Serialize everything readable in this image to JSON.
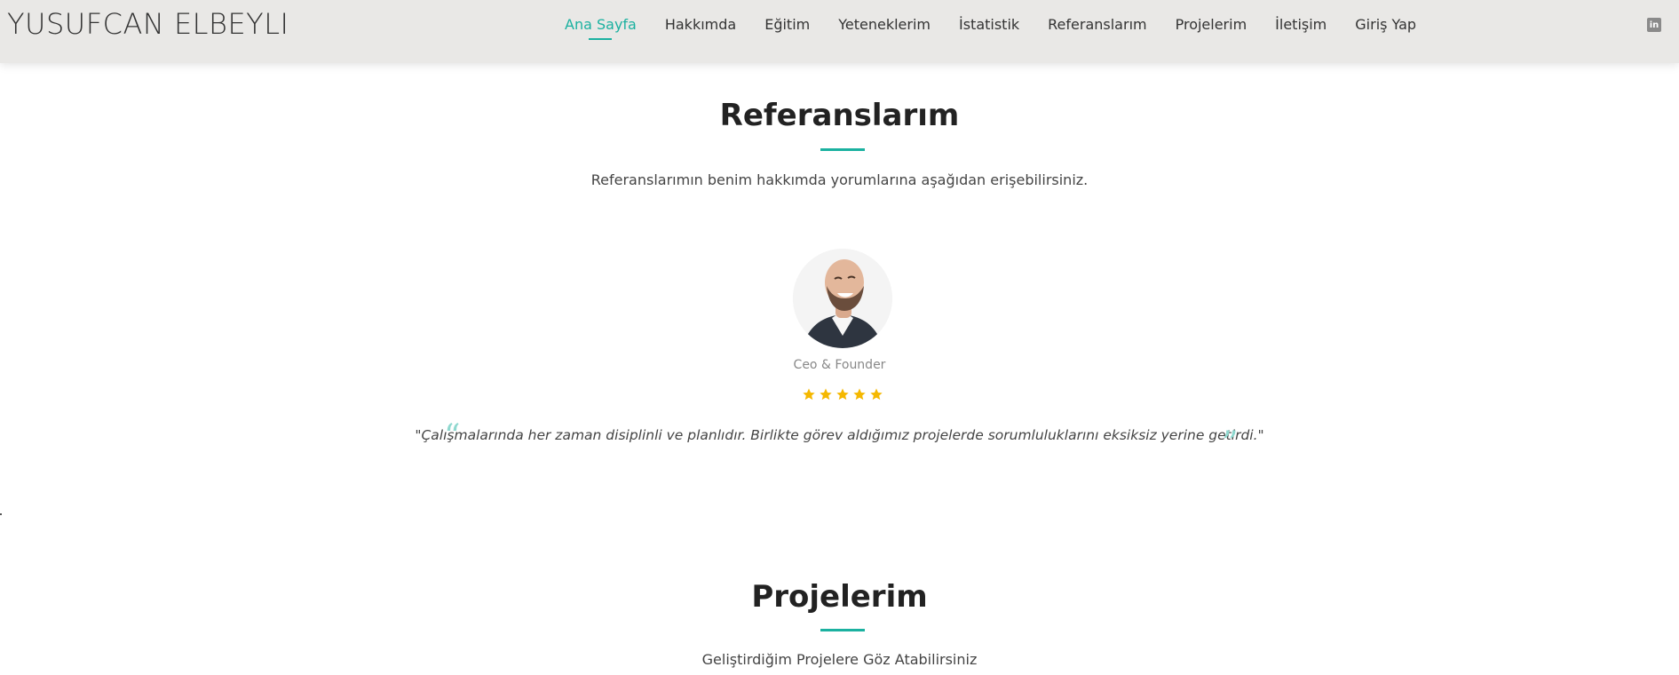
{
  "header": {
    "logo": "YUSUFCAN ELBEYLI",
    "nav": [
      {
        "label": "Ana Sayfa",
        "active": true
      },
      {
        "label": "Hakkımda",
        "active": false
      },
      {
        "label": "Eğitim",
        "active": false
      },
      {
        "label": "Yeteneklerim",
        "active": false
      },
      {
        "label": "İstatistik",
        "active": false
      },
      {
        "label": "Referanslarım",
        "active": false
      },
      {
        "label": "Projelerim",
        "active": false
      },
      {
        "label": "İletişim",
        "active": false
      },
      {
        "label": "Giriş Yap",
        "active": false
      }
    ],
    "social_icon": "linkedin-icon",
    "social_label": "in"
  },
  "references": {
    "title": "Referanslarım",
    "subtitle": "Referanslarımın benim hakkımda yorumlarına aşağıdan erişebilirsiniz.",
    "testimonial": {
      "role": "Ceo & Founder",
      "rating": 5,
      "quote": "\"Çalışmalarında her zaman disiplinli ve planlıdır. Birlikte görev aldığımız projelerde sorumluluklarını eksiksiz yerine getirdi.\""
    }
  },
  "projects": {
    "title": "Projelerim",
    "subtitle": "Geliştirdiğim Projelere Göz Atabilirsiniz"
  },
  "colors": {
    "accent": "#1bb1a0",
    "header_bg": "#e9e8e6",
    "star": "#f5b800"
  }
}
